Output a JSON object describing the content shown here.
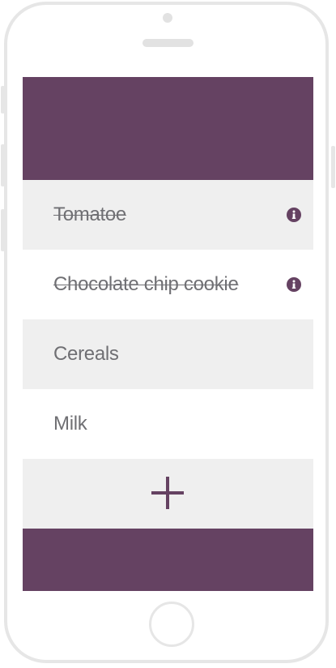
{
  "colors": {
    "accent": "#654262",
    "row_shaded": "#efefef",
    "text": "#6f6f73",
    "frame": "#e6e6e6"
  },
  "list": {
    "items": [
      {
        "label": "Tomatoe",
        "completed": true,
        "info_icon": "info-icon"
      },
      {
        "label": "Chocolate chip cookie",
        "completed": true,
        "info_icon": "info-icon"
      },
      {
        "label": "Cereals",
        "completed": false
      },
      {
        "label": "Milk",
        "completed": false
      }
    ]
  },
  "add_button": {
    "icon": "plus-icon"
  }
}
